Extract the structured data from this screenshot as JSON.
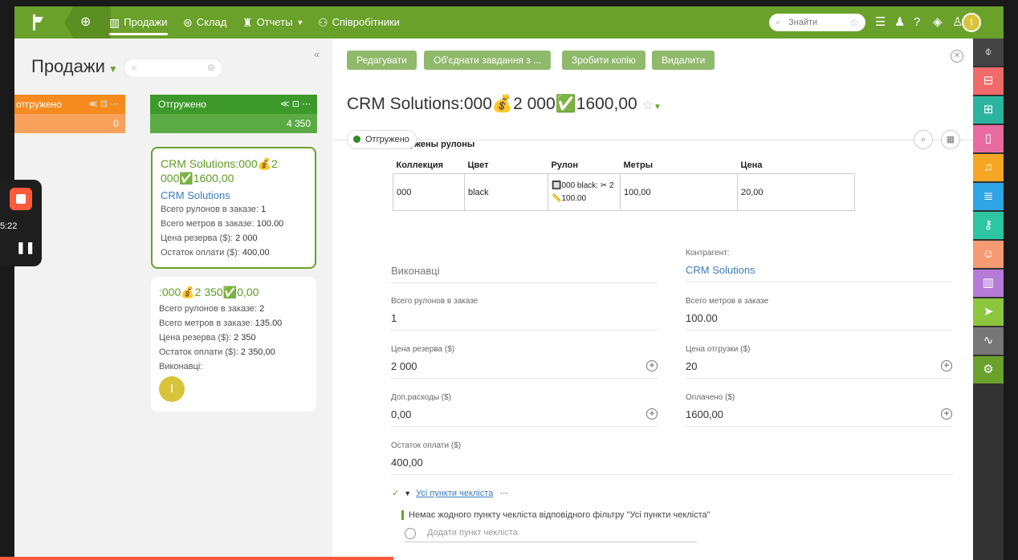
{
  "topbar": {
    "nav": [
      {
        "label": "Продажи",
        "icon": "columns-icon"
      },
      {
        "label": "Склад",
        "icon": "box-icon"
      },
      {
        "label": "Отчеты",
        "icon": "chart-icon"
      },
      {
        "label": "Співробітники",
        "icon": "users-icon"
      }
    ],
    "search_placeholder": "Знайти",
    "avatar_letter": "I"
  },
  "left": {
    "title": "Продажи",
    "columns": [
      {
        "name": "отгружено",
        "sum": "0",
        "color": "#f58b1f"
      },
      {
        "name": "Отгружено",
        "sum": "4 350",
        "color": "#3d9a2a"
      }
    ],
    "cards": [
      {
        "title": "CRM Solutions:000💰2 000✅1600,00",
        "client": "CRM Solutions",
        "rows": [
          {
            "label": "Всего рулонов в заказе:",
            "value": "1"
          },
          {
            "label": "Всего метров в заказе:",
            "value": "100.00"
          },
          {
            "label": "Цена резерва ($):",
            "value": "2 000"
          },
          {
            "label": "Остаток оплати ($):",
            "value": "400,00"
          }
        ]
      },
      {
        "title": ":000💰2 350✅0,00",
        "rows": [
          {
            "label": "Всего рулонов в заказе:",
            "value": "2"
          },
          {
            "label": "Всего метров в заказе:",
            "value": "135.00"
          },
          {
            "label": "Цена резерва ($):",
            "value": "2 350"
          },
          {
            "label": "Остаток оплати ($):",
            "value": "2 350,00"
          },
          {
            "label": "Виконавці:",
            "value": ""
          }
        ],
        "avatar_letter": "I"
      }
    ],
    "recorder_time": "5:22"
  },
  "main": {
    "buttons": [
      "Редагувати",
      "Об'єднати завдання з ...",
      "Зробити копію",
      "Видалити"
    ],
    "title": "CRM Solutions:000💰2 000✅1600,00",
    "status": "Отгружено",
    "table_title": "ужены рулоны",
    "table": {
      "headers": [
        "Коллекция",
        "Цвет",
        "Рулон",
        "Метры",
        "Цена"
      ],
      "rows": [
        [
          "000",
          "black",
          "🔲000 black: ✂ 2📏100.00",
          "100,00",
          "20,00"
        ]
      ]
    },
    "fields": {
      "performers_label": "Виконавці",
      "contractor_label": "Контрагент:",
      "contractor_value": "CRM Solutions",
      "rolls_label": "Всего рулонов в заказе",
      "rolls_value": "1",
      "meters_label": "Всего метров в заказе",
      "meters_value": "100.00",
      "reserve_label": "Цена резерва ($)",
      "reserve_value": "2 000",
      "ship_label": "Цена отгрузки ($)",
      "ship_value": "20",
      "extra_label": "Доп.расходы ($)",
      "extra_value": "0,00",
      "paid_label": "Оплачено ($)",
      "paid_value": "1600,00",
      "rest_label": "Остаток оплати ($)",
      "rest_value": "400,00"
    },
    "checklist": {
      "filter": "Усі пункти чекліста",
      "empty": "Немає жодного пункту чекліста відповідного фільтру \"Усі пункти чекліста\"",
      "add_placeholder": "Додати пункт чекліста"
    }
  },
  "rightbar": [
    {
      "icon": "funnel-icon",
      "color": "#444"
    },
    {
      "icon": "inbox-icon",
      "color": "#f06a6a"
    },
    {
      "icon": "flow-icon",
      "color": "#2bb5a0"
    },
    {
      "icon": "docs-icon",
      "color": "#e86ba0"
    },
    {
      "icon": "bell-icon",
      "color": "#f5a623"
    },
    {
      "icon": "list-icon",
      "color": "#2fa4e7"
    },
    {
      "icon": "key-icon",
      "color": "#2cc6a2"
    },
    {
      "icon": "contact-icon",
      "color": "#f59a72"
    },
    {
      "icon": "stats-icon",
      "color": "#b57bd6"
    },
    {
      "icon": "send-icon",
      "color": "#8cc63f"
    },
    {
      "icon": "pulse-icon",
      "color": "#777"
    },
    {
      "icon": "gear-icon",
      "color": "#6aa12b"
    }
  ]
}
